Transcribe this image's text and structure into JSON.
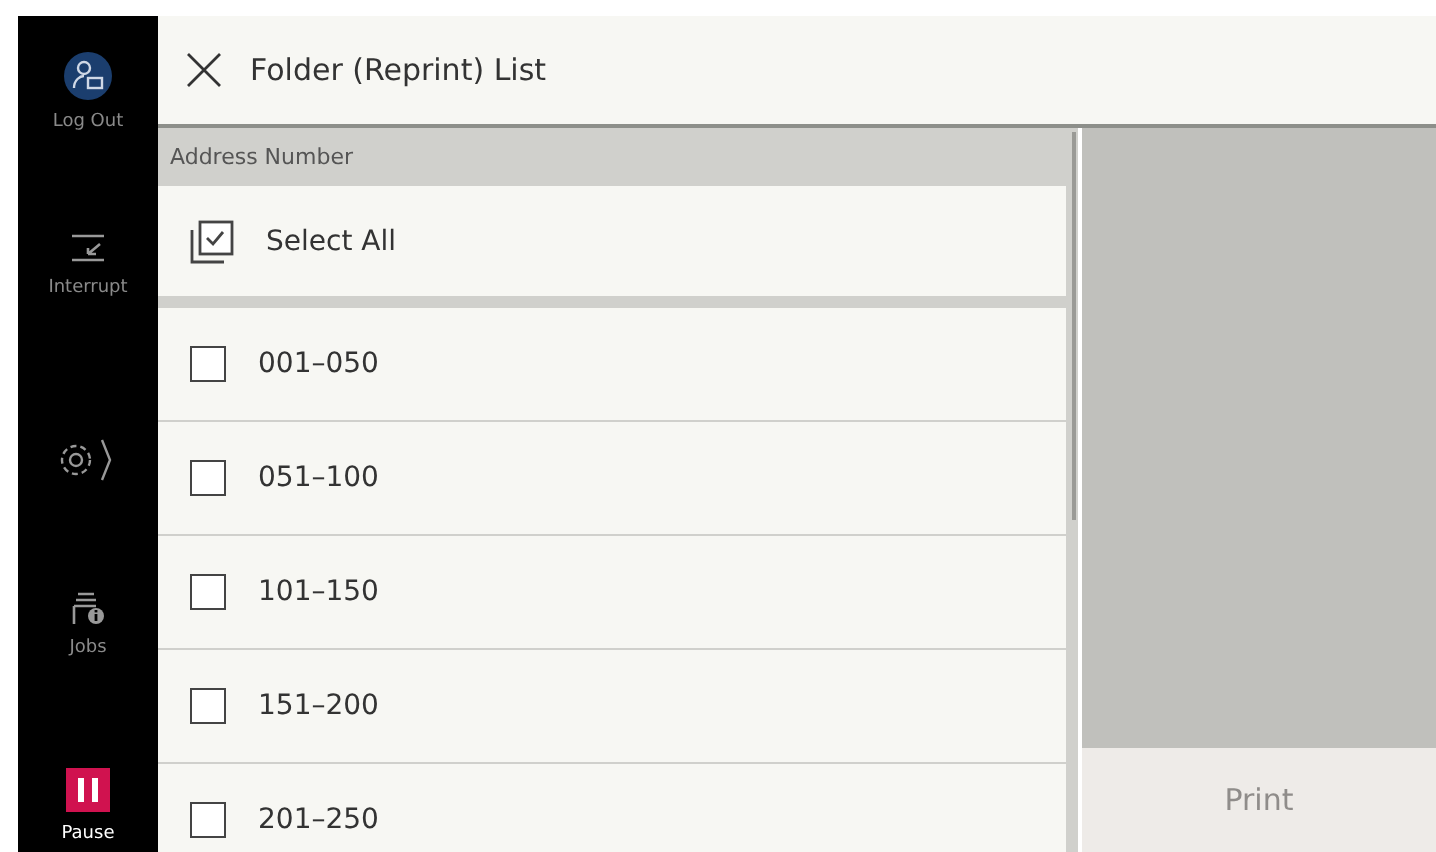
{
  "sidebar": {
    "items": [
      {
        "kind": "logout",
        "label": "Log Out"
      },
      {
        "kind": "interrupt",
        "label": "Interrupt"
      },
      {
        "kind": "settings"
      },
      {
        "kind": "jobs",
        "label": "Jobs"
      },
      {
        "kind": "pause",
        "label": "Pause"
      }
    ]
  },
  "header": {
    "title": "Folder (Reprint) List"
  },
  "list": {
    "column_header": "Address Number",
    "select_all": {
      "label": "Select All",
      "checked": false
    },
    "items": [
      {
        "label": "001–050",
        "checked": false
      },
      {
        "label": "051–100",
        "checked": false
      },
      {
        "label": "101–150",
        "checked": false
      },
      {
        "label": "151–200",
        "checked": false
      },
      {
        "label": "201–250",
        "checked": false
      }
    ]
  },
  "print_button": {
    "label": "Print",
    "disabled": true
  }
}
